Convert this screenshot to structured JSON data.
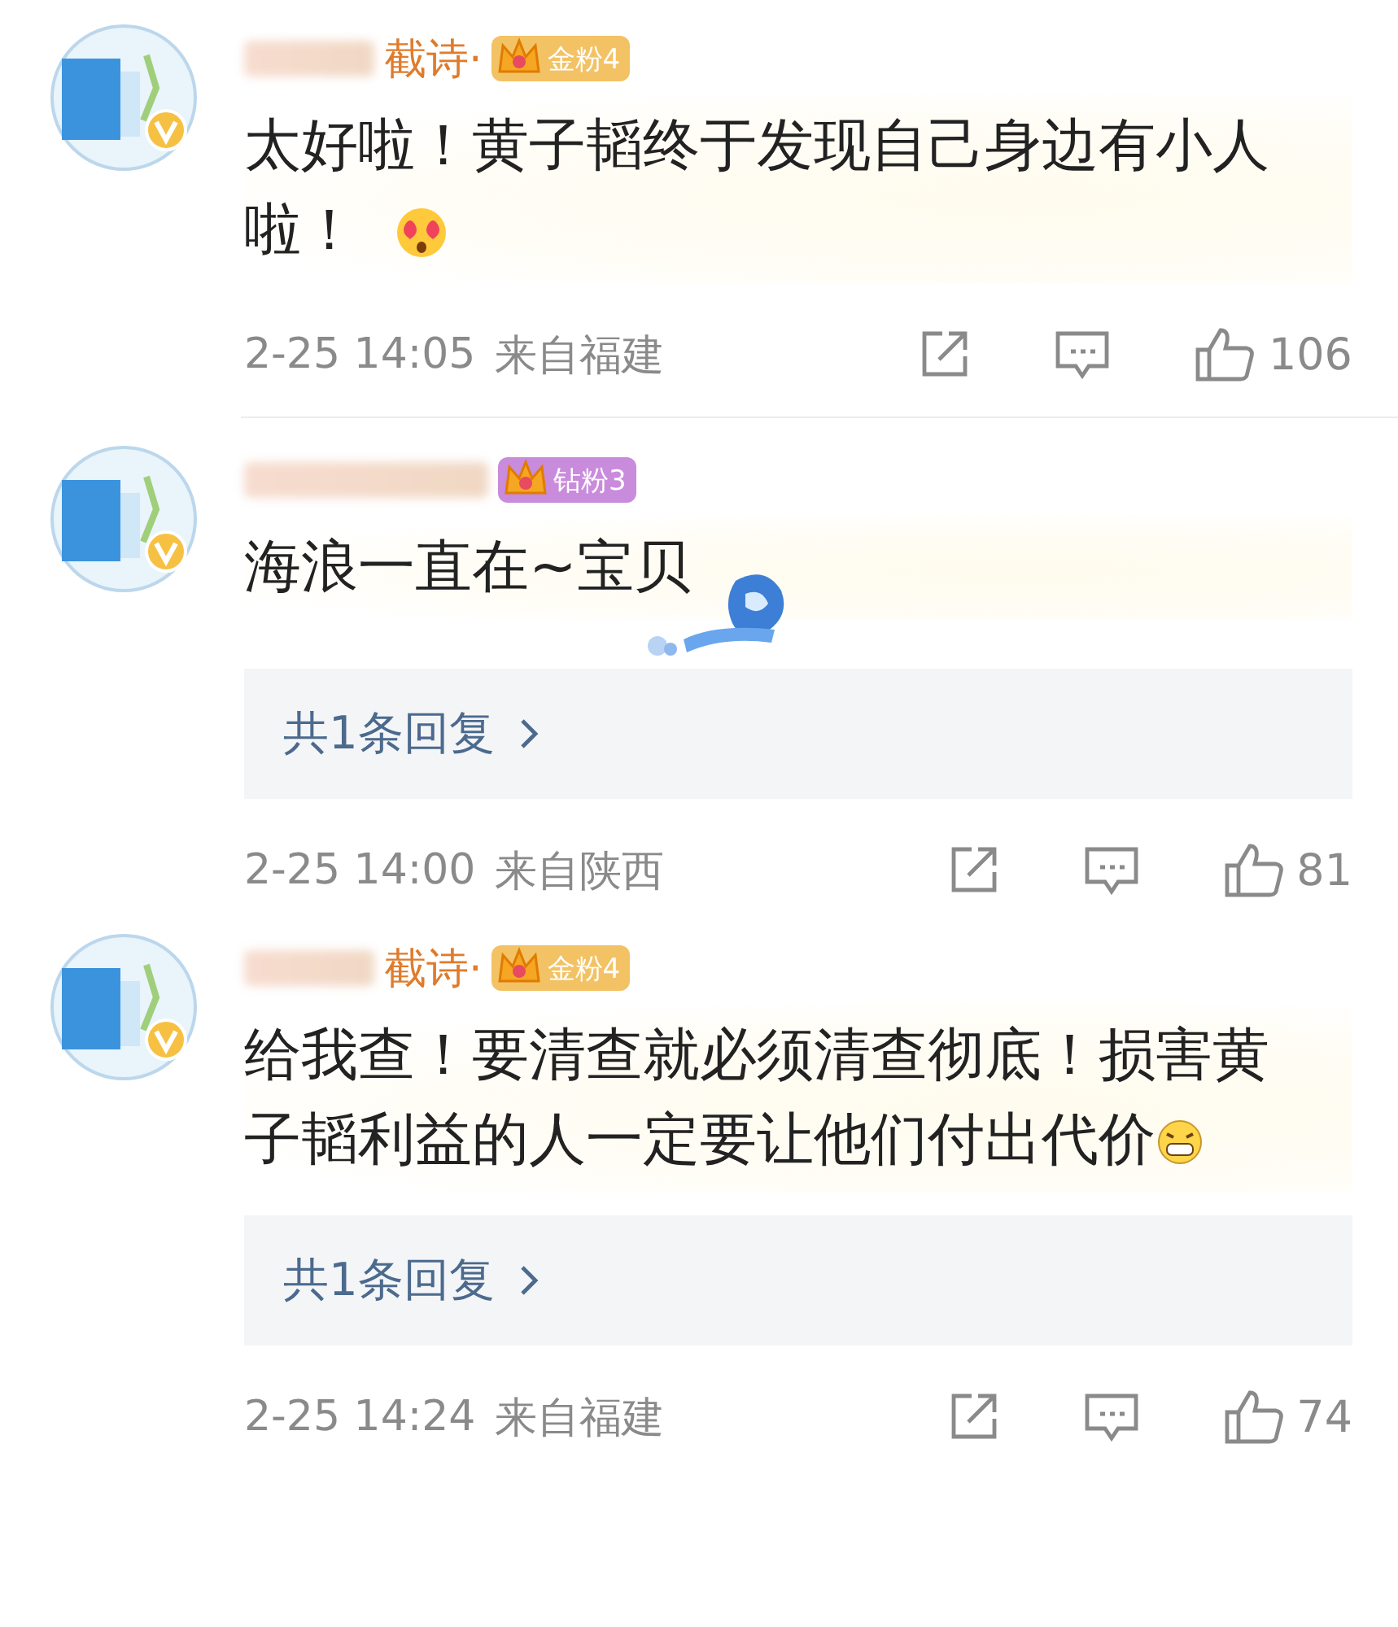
{
  "comments": [
    {
      "name": "截诗·",
      "badge": {
        "label": "金粉4",
        "color": "#f3c264"
      },
      "text": "太好啦！黄子韬终于发现自己身边有小人啦！",
      "decor": {
        "kind": "heart-eyes"
      },
      "time": "2-25 14:05",
      "location": "来自福建",
      "likes": "106",
      "divider": true
    },
    {
      "badge": {
        "label": "钻粉3",
        "color": "#c98bdc"
      },
      "text": "海浪一直在~宝贝",
      "decor": {
        "kind": "sticker"
      },
      "time": "2-25 14:00",
      "location": "来自陕西",
      "likes": "81",
      "reply": "共1条回复",
      "divider": false
    },
    {
      "name": "截诗·",
      "badge": {
        "label": "金粉4",
        "color": "#f3c264"
      },
      "text": "给我查！要清查就必须清查彻底！损害黄子韬利益的人一定要让他们付出代价",
      "decor": {
        "kind": "grin"
      },
      "time": "2-25 14:24",
      "location": "来自福建",
      "likes": "74",
      "reply": "共1条回复",
      "divider": false
    }
  ]
}
